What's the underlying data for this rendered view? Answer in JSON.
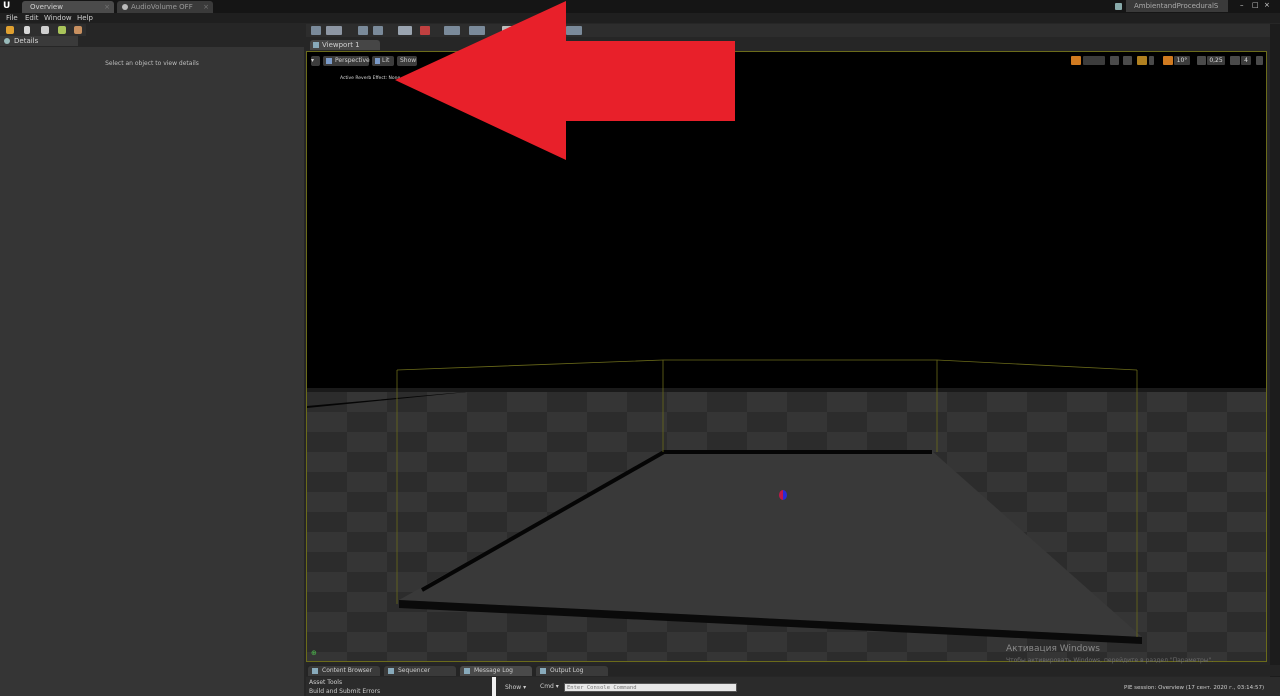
{
  "window": {
    "tabs": [
      {
        "label": "Overview",
        "active": true
      },
      {
        "label": "AudioVolume OFF",
        "active": false
      }
    ],
    "project_name": "AmbientandProceduralS"
  },
  "menu": [
    "File",
    "Edit",
    "Window",
    "Help"
  ],
  "details": {
    "tab_label": "Details",
    "empty_message": "Select an object to view details"
  },
  "viewport": {
    "tab_label": "Viewport 1",
    "view_mode": "Perspective",
    "lighting": "Lit",
    "show_label": "Show",
    "overlay_text": "Active Reverb Effect: None",
    "snap_angle": "10°",
    "snap_scale": "0,25",
    "camera_speed": "4"
  },
  "watermark": {
    "title": "Активация Windows",
    "subtitle": "Чтобы активировать Windows, перейдите в раздел \"Параметры\"."
  },
  "bottom_tabs": [
    "Content Browser",
    "Sequencer",
    "Message Log",
    "Output Log"
  ],
  "bottom": {
    "asset_tools": "Asset Tools",
    "build_submit": "Build and Submit Errors",
    "show_label": "Show",
    "cmd_label": "Cmd",
    "console_placeholder": "Enter Console Command",
    "status": "PIE session: Overview (17 сент. 2020 г., 03:14:57)"
  },
  "colors": {
    "annotation_arrow": "#e8202a",
    "volume_outline": "#6b6b1a"
  }
}
